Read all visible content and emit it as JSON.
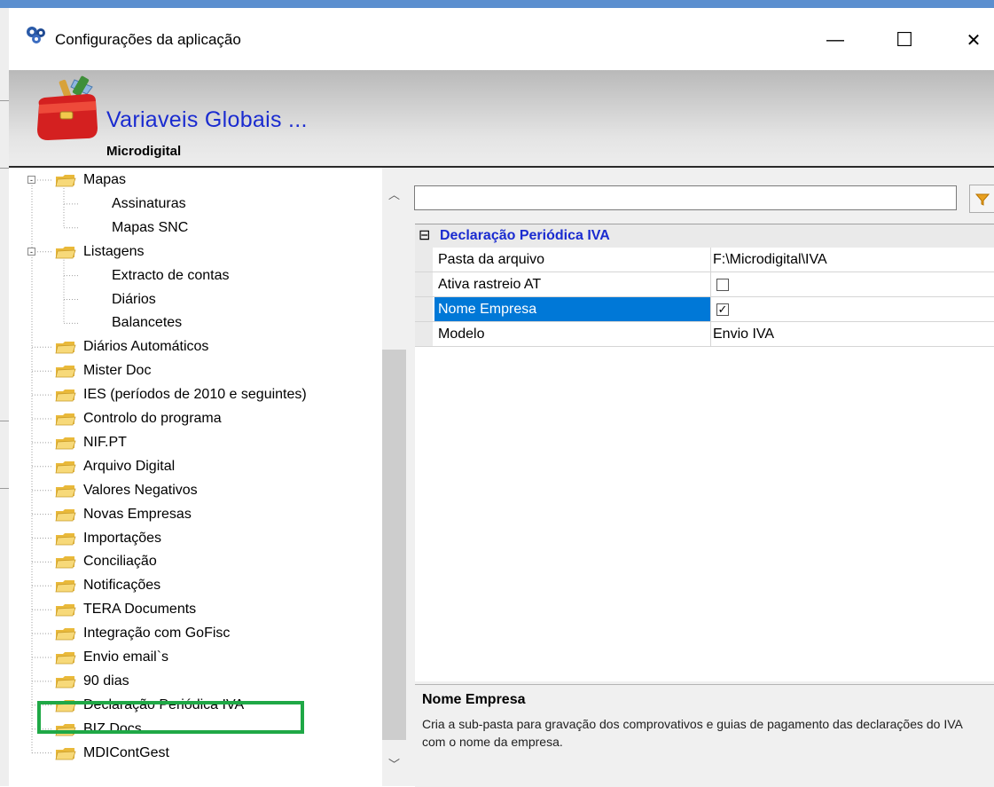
{
  "window": {
    "title": "Configurações da aplicação",
    "minimize_glyph": "—",
    "maximize_glyph": "☐",
    "close_glyph": "✕"
  },
  "header": {
    "title": "Variaveis Globais ...",
    "subtitle": "Microdigital"
  },
  "tree": [
    {
      "label": "Mapas",
      "level": 0,
      "expanded": true
    },
    {
      "label": "Assinaturas",
      "level": 1
    },
    {
      "label": "Mapas SNC",
      "level": 1
    },
    {
      "label": "Listagens",
      "level": 0,
      "expanded": true
    },
    {
      "label": "Extracto de contas",
      "level": 1
    },
    {
      "label": "Diários",
      "level": 1
    },
    {
      "label": "Balancetes",
      "level": 1
    },
    {
      "label": "Diários Automáticos",
      "level": 0
    },
    {
      "label": "Mister Doc",
      "level": 0
    },
    {
      "label": "IES (períodos de 2010 e seguintes)",
      "level": 0
    },
    {
      "label": "Controlo do programa",
      "level": 0
    },
    {
      "label": "NIF.PT",
      "level": 0
    },
    {
      "label": "Arquivo Digital",
      "level": 0
    },
    {
      "label": "Valores Negativos",
      "level": 0
    },
    {
      "label": "Novas Empresas",
      "level": 0
    },
    {
      "label": "Importações",
      "level": 0
    },
    {
      "label": "Conciliação",
      "level": 0
    },
    {
      "label": "Notificações",
      "level": 0
    },
    {
      "label": "TERA Documents",
      "level": 0
    },
    {
      "label": "Integração com GoFisc",
      "level": 0
    },
    {
      "label": "Envio email`s",
      "level": 0
    },
    {
      "label": "90 dias",
      "level": 0
    },
    {
      "label": "Declaração Periódica IVA",
      "level": 0,
      "selected": true
    },
    {
      "label": "BIZ Docs",
      "level": 0
    },
    {
      "label": "MDIContGest",
      "level": 0
    }
  ],
  "property_grid": {
    "filter_value": "",
    "category": {
      "label": "Declaração Periódica IVA",
      "toggle": "⊟"
    },
    "rows": [
      {
        "name": "Pasta da arquivo",
        "value": "F:\\Microdigital\\IVA"
      },
      {
        "name": "Ativa rastreio AT",
        "checkbox": false
      },
      {
        "name": "Nome Empresa",
        "checkbox": true,
        "selected": true
      },
      {
        "name": "Modelo",
        "value": "Envio IVA"
      }
    ]
  },
  "description": {
    "title": "Nome Empresa",
    "text": "Cria a sub-pasta para gravação dos comprovativos e guias de pagamento das declarações do IVA com o nome da empresa."
  },
  "colors": {
    "accent_blue": "#1a2bd0",
    "selection": "#0078d7",
    "highlight_green": "#1fa846",
    "folder": "#f3c64a"
  }
}
